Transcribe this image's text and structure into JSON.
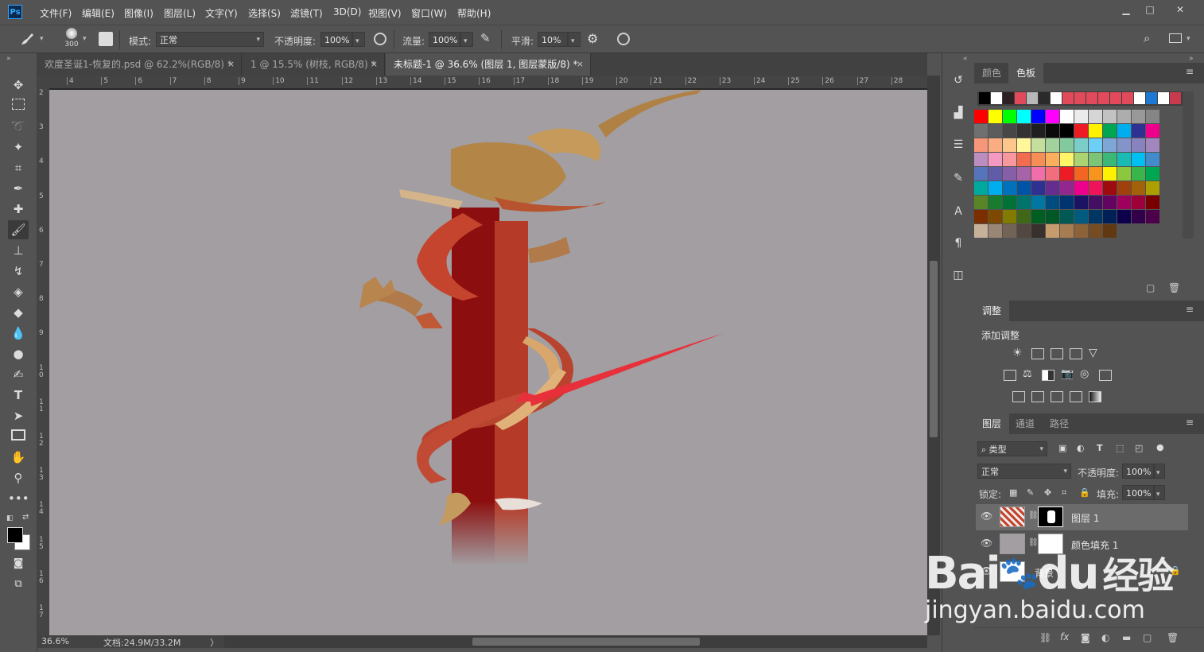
{
  "app": {
    "logo": "Ps"
  },
  "menu": [
    "文件(F)",
    "编辑(E)",
    "图像(I)",
    "图层(L)",
    "文字(Y)",
    "选择(S)",
    "滤镜(T)",
    "3D(D)",
    "视图(V)",
    "窗口(W)",
    "帮助(H)"
  ],
  "window_controls": {
    "minimize": "▁",
    "maximize": "□",
    "close": "✕"
  },
  "options": {
    "brush_size": "300",
    "mode_label": "模式:",
    "mode_value": "正常",
    "opacity_label": "不透明度:",
    "opacity_value": "100%",
    "flow_label": "流量:",
    "flow_value": "100%",
    "smooth_label": "平滑:",
    "smooth_value": "10%"
  },
  "tabs": [
    {
      "label": "欢度圣诞1-恢复的.psd @ 62.2%(RGB/8) *",
      "close": "×"
    },
    {
      "label": "1 @ 15.5% (树枝, RGB/8) *",
      "close": "×"
    },
    {
      "label": "未标题-1 @ 36.6% (图层 1, 图层蒙版/8) *",
      "close": "×"
    }
  ],
  "ruler": {
    "h": [
      "4",
      "5",
      "6",
      "7",
      "8",
      "9",
      "10",
      "11",
      "12",
      "13",
      "14",
      "15",
      "16",
      "17",
      "18",
      "19",
      "20",
      "21",
      "22",
      "23",
      "24",
      "25",
      "26",
      "27",
      "28"
    ],
    "v": [
      "2",
      "3",
      "4",
      "5",
      "6",
      "7",
      "8",
      "9",
      "10",
      "11",
      "12",
      "13",
      "14",
      "15",
      "16",
      "17"
    ]
  },
  "status": {
    "zoom": "36.6%",
    "doc": "文档:24.9M/33.2M",
    "arrow": "〉"
  },
  "swatch_panel": {
    "tabs": [
      "颜色",
      "色板"
    ],
    "active": "色板",
    "recent": [
      "#000000",
      "#ffffff",
      "#2d2022",
      "#e04a5a",
      "#b8b8b8",
      "#2a2a2a",
      "#ffffff",
      "#e04a5a",
      "#e04a5a",
      "#e04a5a",
      "#e04a5a",
      "#e04a5a",
      "#e04a5a",
      "#ffffff",
      "#1e78d6",
      "#ffffff",
      "#c83a4e"
    ],
    "rows": [
      [
        "#ff0000",
        "#ffff00",
        "#00ff00",
        "#00ffff",
        "#0000ff",
        "#ff00ff",
        "#ffffff",
        "#ebebeb",
        "#d6d6d6",
        "#c2c2c2",
        "#adadad",
        "#999999",
        "#858585"
      ],
      [
        "#707070",
        "#5c5c5c",
        "#474747",
        "#333333",
        "#1f1f1f",
        "#0a0a0a",
        "#000000",
        "#ed1c24",
        "#fff200",
        "#00a651",
        "#00aeef",
        "#2e3192",
        "#ec008c"
      ],
      [
        "#f7977a",
        "#f9ad81",
        "#fdc68a",
        "#fff79a",
        "#c4df9b",
        "#a3d39c",
        "#82ca9d",
        "#7bcdc8",
        "#6ecff6",
        "#7ea7d8",
        "#8493ca",
        "#8882be",
        "#a187be"
      ],
      [
        "#bc8dbf",
        "#f49ac2",
        "#f6989d",
        "#f26c4f",
        "#f68e55",
        "#fbaf5c",
        "#fff467",
        "#acd372",
        "#7cc576",
        "#3bb878",
        "#1abbb4",
        "#00bff3",
        "#438ccb"
      ],
      [
        "#5574b9",
        "#605ca8",
        "#855fa8",
        "#a763a8",
        "#f06ea9",
        "#f26d7d",
        "#ed1c24",
        "#f26522",
        "#f7941d",
        "#fff200",
        "#8dc73f",
        "#39b54a",
        "#00a651"
      ],
      [
        "#00a99d",
        "#00aeef",
        "#0072bc",
        "#0054a6",
        "#2e3192",
        "#662d91",
        "#92278f",
        "#ec008c",
        "#ed145b",
        "#9e0b0f",
        "#a0410d",
        "#a36209",
        "#aba000"
      ],
      [
        "#598527",
        "#197b30",
        "#007236",
        "#00746b",
        "#0076a3",
        "#004b80",
        "#003471",
        "#1b1464",
        "#440e62",
        "#630460",
        "#9e005d",
        "#9e0039",
        "#790000"
      ],
      [
        "#7b2e00",
        "#7d4900",
        "#827b00",
        "#406618",
        "#005e20",
        "#005826",
        "#005952",
        "#005b7f",
        "#003663",
        "#002157",
        "#0d004c",
        "#32004b",
        "#4b0049"
      ],
      [
        "#c7b299",
        "#998675",
        "#736357",
        "#534741",
        "#37302d",
        "#c69c6d",
        "#a67c52",
        "#8c6239",
        "#754c24",
        "#603913"
      ]
    ]
  },
  "adjustments": {
    "tab": "调整",
    "add_label": "添加调整",
    "row1": [
      "brightness-icon",
      "levels-icon",
      "curves-icon",
      "exposure-icon",
      "vibrance-icon"
    ],
    "row2": [
      "hue-icon",
      "colorbalance-icon",
      "bw-icon",
      "photofilter-icon",
      "channelmixer-icon",
      "lookup-icon"
    ],
    "row3": [
      "invert-icon",
      "posterize-icon",
      "threshold-icon",
      "selectivecolor-icon",
      "gradientmap-icon"
    ]
  },
  "layers_panel": {
    "tabs": [
      "图层",
      "通道",
      "路径"
    ],
    "filter_label": "类型",
    "blend_mode": "正常",
    "opacity_label": "不透明度:",
    "opacity_value": "100%",
    "lock_label": "锁定:",
    "fill_label": "填充:",
    "fill_value": "100%",
    "layers": [
      {
        "name": "图层 1",
        "selected": true
      },
      {
        "name": "颜色填充 1",
        "selected": false
      },
      {
        "name": "背景",
        "selected": false
      }
    ]
  },
  "watermark": {
    "logo": "Bai",
    "paw": "du",
    "title": "经验",
    "url": "jingyan.baidu.com"
  },
  "colors": {
    "canvas_bg": "#a29ea1",
    "ui_bg": "#535353",
    "accent": "#31a8ff",
    "arrow": "#e8303a"
  }
}
